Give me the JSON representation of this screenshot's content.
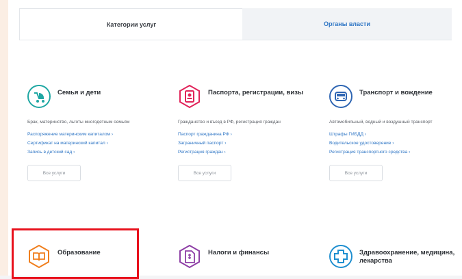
{
  "tabs": [
    {
      "label": "Категории услуг"
    },
    {
      "label": "Органы власти"
    }
  ],
  "cards": [
    {
      "title": "Семья и дети",
      "icon": "baby-stroller-icon",
      "color": "#1fa7a3",
      "description": "Брак, материнство, льготы многодетным семьям",
      "links": [
        "Распоряжение материнским капиталом ›",
        "Сертификат на материнский капитал ›",
        "Запись в детский сад ›"
      ],
      "button": "Все услуги"
    },
    {
      "title": "Паспорта, регистрации, визы",
      "icon": "passport-icon",
      "color": "#e1245a",
      "description": "Гражданство и въезд в РФ, регистрация граждан",
      "links": [
        "Паспорт гражданина РФ ›",
        "Заграничный паспорт ›",
        "Регистрация граждан ›"
      ],
      "button": "Все услуги"
    },
    {
      "title": "Транспорт и вождение",
      "icon": "car-icon",
      "color": "#2f66b3",
      "description": "Автомобильный, водный и воздушный транспорт",
      "links": [
        "Штрафы ГИБДД ›",
        "Водительское удостоверение ›",
        "Регистрация транспортного средства ›"
      ],
      "button": "Все услуги"
    },
    {
      "title": "Образование",
      "icon": "book-icon",
      "color": "#f07f1e"
    },
    {
      "title": "Налоги и финансы",
      "icon": "tax-document-icon",
      "color": "#8e3fa6"
    },
    {
      "title": "Здравоохранение, медицина, лекарства",
      "icon": "medical-cross-icon",
      "color": "#1f8fd0"
    }
  ]
}
